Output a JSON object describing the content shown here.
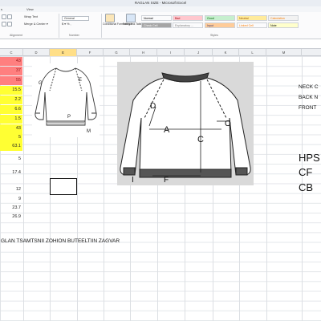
{
  "window": {
    "title": "RAGLAN SIZE - Microsoft Excel"
  },
  "ribbon_tabs": [
    "s",
    "View"
  ],
  "ribbon": {
    "wrap_text": "Wrap Text",
    "merge_center": "Merge & Center ▾",
    "number_format": "General",
    "number_buttons": "$ ▾ % ,",
    "conditional_formatting": "Conditional Formatting ▾",
    "format_as_table": "Format as Table ▾",
    "group_alignment": "Alignment",
    "group_number": "Number",
    "group_styles": "Styles",
    "styles": [
      {
        "label": "Normal",
        "bg": "#ffffff",
        "fg": "#222222"
      },
      {
        "label": "Bad",
        "bg": "#ffc7ce",
        "fg": "#9c0006"
      },
      {
        "label": "Good",
        "bg": "#c6efce",
        "fg": "#006100"
      },
      {
        "label": "Neutral",
        "bg": "#ffeb9c",
        "fg": "#9c5700"
      },
      {
        "label": "Calculation",
        "bg": "#f2f2f2",
        "fg": "#fa7d00"
      },
      {
        "label": "Check Cell",
        "bg": "#a5a5a5",
        "fg": "#ffffff"
      },
      {
        "label": "Explanatory ...",
        "bg": "#ffffff",
        "fg": "#7f7f7f"
      },
      {
        "label": "Input",
        "bg": "#ffcc99",
        "fg": "#3f3f76"
      },
      {
        "label": "Linked Cell",
        "bg": "#ffffff",
        "fg": "#fa7d00"
      },
      {
        "label": "Note",
        "bg": "#ffffcc",
        "fg": "#333333"
      }
    ]
  },
  "columns": [
    "C",
    "D",
    "E",
    "F",
    "G",
    "H",
    "I",
    "J",
    "K",
    "L",
    "M"
  ],
  "selected_column": "E",
  "column_c_cells": [
    {
      "value": "43",
      "style": "red"
    },
    {
      "value": "37",
      "style": "red"
    },
    {
      "value": "55",
      "style": "red"
    },
    {
      "value": "15.5",
      "style": "yel"
    },
    {
      "value": "2.2",
      "style": "yel"
    },
    {
      "value": "6.6",
      "style": "yel"
    },
    {
      "value": "1.5",
      "style": "yel"
    },
    {
      "value": "43",
      "style": "yel"
    },
    {
      "value": "5",
      "style": "yel"
    },
    {
      "value": "63.1",
      "style": "yel"
    },
    {
      "value": "",
      "style": "none"
    },
    {
      "value": "5",
      "style": "none"
    },
    {
      "value": "",
      "style": "none"
    },
    {
      "value": "17.4",
      "style": "none"
    },
    {
      "value": "",
      "style": "none"
    },
    {
      "value": "12",
      "style": "none"
    },
    {
      "value": "9",
      "style": "none"
    },
    {
      "value": "23.7",
      "style": "none"
    },
    {
      "value": "26.9",
      "style": "none"
    }
  ],
  "right_labels": [
    "NECK C",
    "BACK N",
    "FRONT"
  ],
  "big_labels": [
    "HPS",
    "CF",
    "CB"
  ],
  "footer_text": "GLAN TSAMTSNII ZOHION BUTEELTIIN ZAGVAR",
  "small_sketch_labels": [
    "G",
    "E",
    "P",
    "M"
  ],
  "large_sketch_labels": [
    "D",
    "A",
    "C",
    "O",
    "I",
    "F"
  ],
  "colors": {
    "red_fill": "#ff7f7f",
    "yellow_fill": "#ffff33",
    "selected_header": "#ffdf88"
  }
}
